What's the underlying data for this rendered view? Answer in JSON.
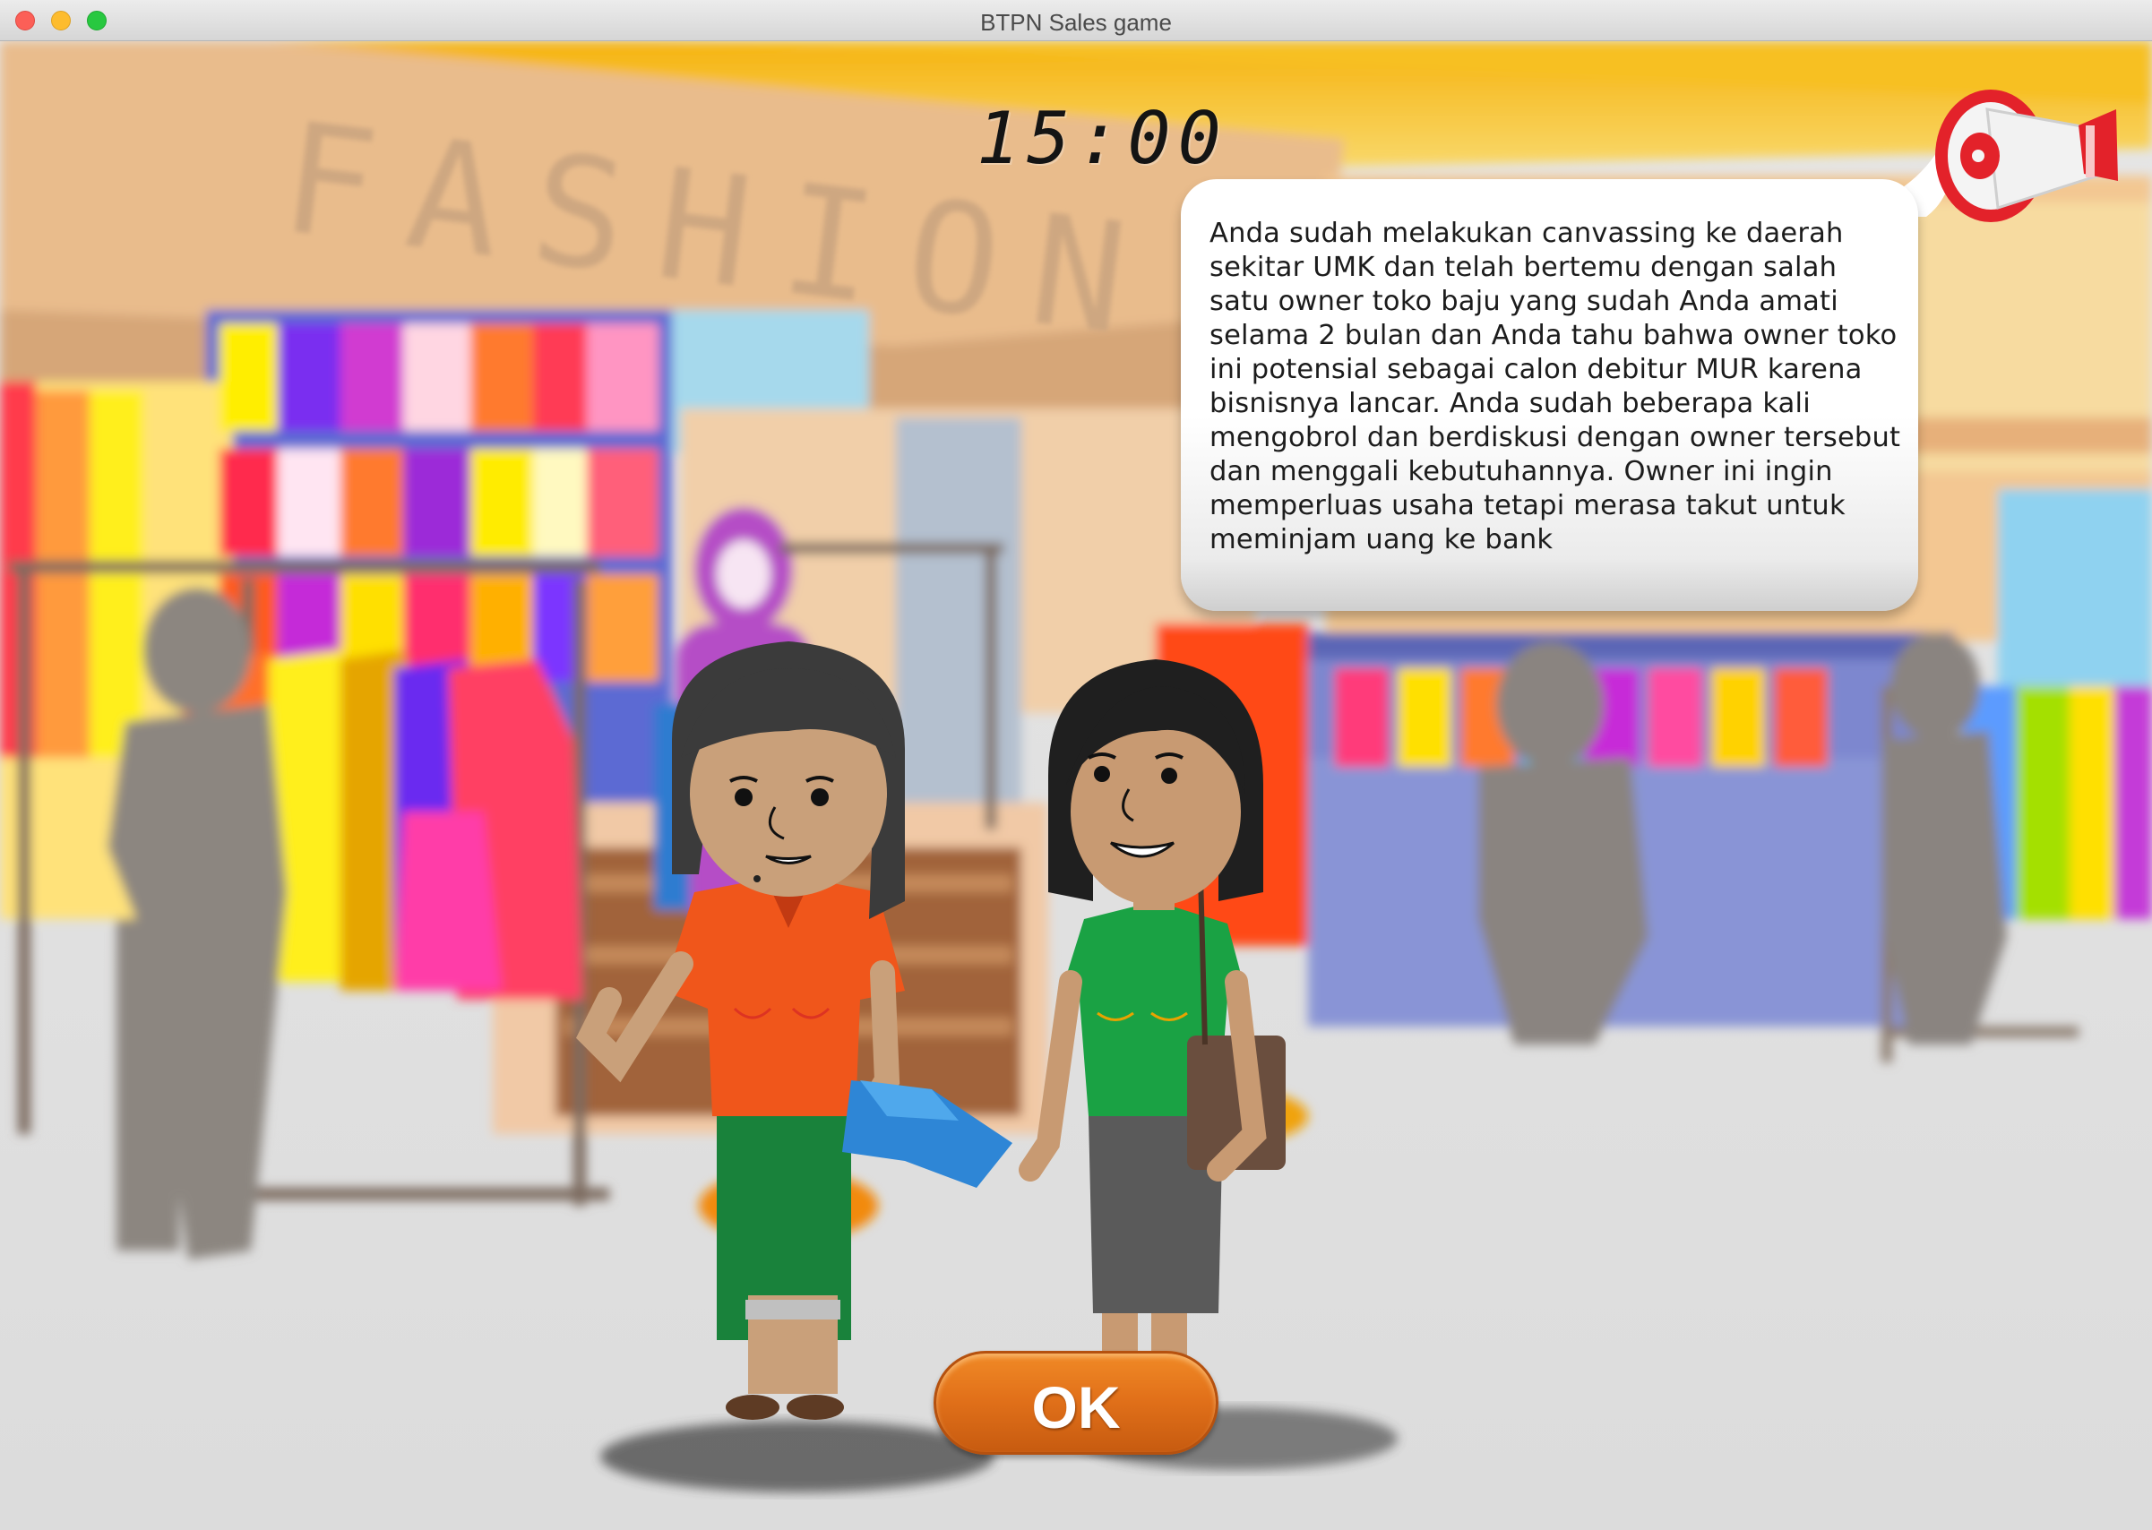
{
  "window": {
    "title": "BTPN Sales game"
  },
  "game": {
    "timer": "15:00",
    "store_sign": "FASHION",
    "message": "Anda sudah melakukan canvassing ke daerah sekitar UMK dan telah bertemu dengan salah satu owner toko baju yang sudah Anda amati selama 2 bulan dan Anda tahu bahwa owner toko ini potensial sebagai calon debitur MUR karena bisnisnya lancar. Anda sudah beberapa kali mengobrol dan berdiskusi dengan owner tersebut dan menggali kebutuhannya. Owner ini ingin memperluas usaha tetapi merasa takut untuk meminjam uang ke bank",
    "ok_label": "OK"
  },
  "icons": {
    "announcement": "megaphone-icon"
  },
  "colors": {
    "accent_orange": "#e2711a",
    "banner_yellow": "#f7b718",
    "speech_bubble": "#ffffff"
  }
}
